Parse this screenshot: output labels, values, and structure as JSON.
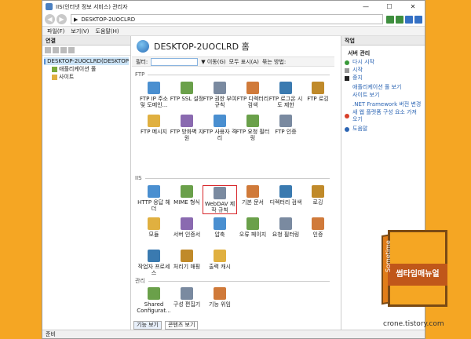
{
  "window": {
    "title": "IIS(인터넷 정보 서비스) 관리자",
    "min": "—",
    "max": "☐",
    "close": "✕"
  },
  "address": {
    "back": "◀",
    "forward": "▶",
    "path": "DESKTOP-2UOCLRD",
    "sep": "▶"
  },
  "menu": [
    "파일(F)",
    "보기(V)",
    "도움말(H)"
  ],
  "left": {
    "header": "연결",
    "tree": [
      {
        "label": "DESKTOP-2UOCLRD(DESKTOP",
        "selected": true
      },
      {
        "label": "애플리케이션 풀",
        "selected": false
      },
      {
        "label": "사이트",
        "selected": false
      }
    ]
  },
  "center": {
    "title": "DESKTOP-2UOCLRD 홈",
    "filter_label": "필터:",
    "filter_go": "▼ 이동(G)",
    "show_all": "모두 표시(A)",
    "group_by": "묶는 방법:",
    "sections": [
      "FTP",
      "IIS",
      "관리"
    ],
    "ftp_items": [
      "FTP IP 주소 및 도메인...",
      "FTP SSL 설정",
      "FTP 권한 부여 규칙",
      "FTP 디렉터리 검색",
      "FTP 로그온 시도 제한",
      "FTP 로깅",
      "FTP 메시지",
      "FTP 방화벽 지원",
      "FTP 사용자 격리",
      "FTP 요청 필터링",
      "FTP 인증"
    ],
    "iis_items": [
      "HTTP 응답 헤더",
      "MIME 형식",
      "WebDAV 제작 규칙",
      "기본 문서",
      "디렉터리 검색",
      "로깅",
      "모듈",
      "서버 인증서",
      "압축",
      "오류 페이지",
      "요청 필터링",
      "인증",
      "작업자 프로세스",
      "처리기 매핑",
      "출력 캐시"
    ],
    "mgmt_items": [
      "Shared Configurat...",
      "구성 편집기",
      "기능 위임"
    ],
    "tabs": [
      "기능 보기",
      "콘텐츠 보기"
    ]
  },
  "right": {
    "header": "작업",
    "group": "서버 관리",
    "actions": [
      "다시 시작",
      "시작",
      "중지",
      "애플리케이션 풀 보기",
      "사이트 보기",
      ".NET Framework 버전 변경",
      "새 웹 플랫폼 구성 요소 가져오기",
      "도움말"
    ]
  },
  "status": "준비",
  "brand": {
    "name": "썸타임매뉴얼",
    "spine": "Sometime",
    "url": "crone.tistory.com"
  },
  "colors": {
    "accent": "#f5a623",
    "highlight": "#d8262a",
    "link": "#2b64b3"
  }
}
